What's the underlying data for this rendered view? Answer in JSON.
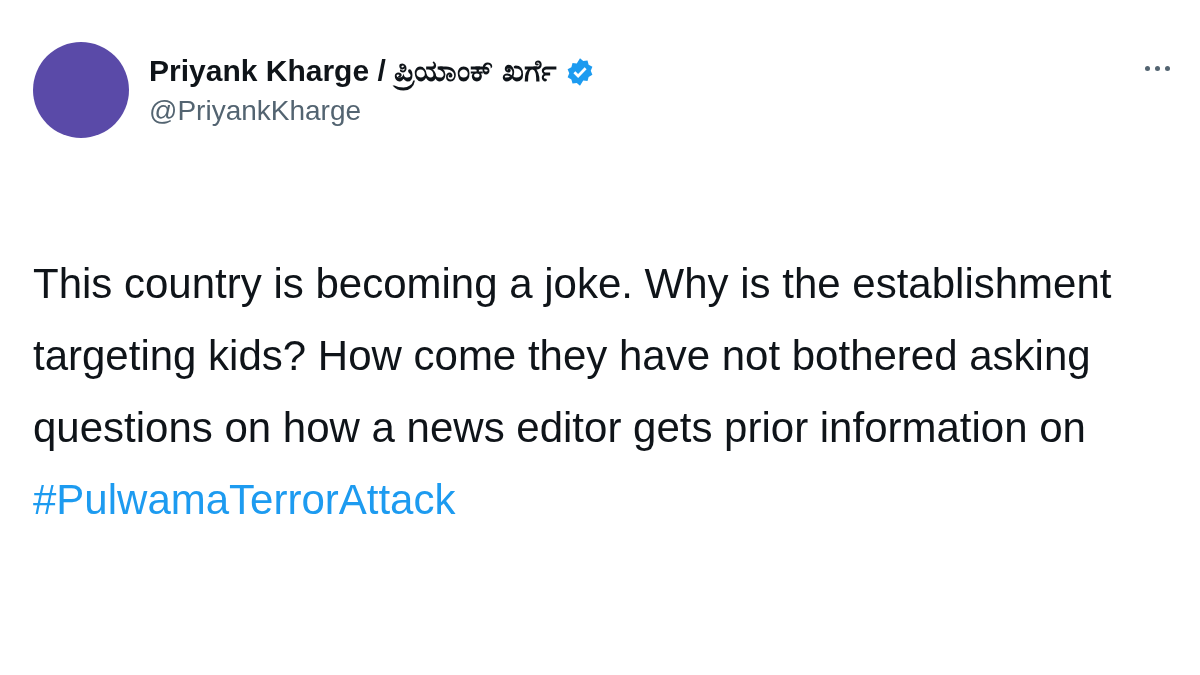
{
  "author": {
    "name": "Priyank Kharge / ಪ್ರಿಯಾಂಕ್ ಖರ್ಗೆ",
    "verified": true,
    "handle": "@PriyankKharge"
  },
  "tweet": {
    "text": "This country is becoming a joke. Why is the establishment targeting kids? How come they have not bothered asking questions on how a news editor gets prior information on",
    "hashtag": "#PulwamaTerrorAttack"
  }
}
